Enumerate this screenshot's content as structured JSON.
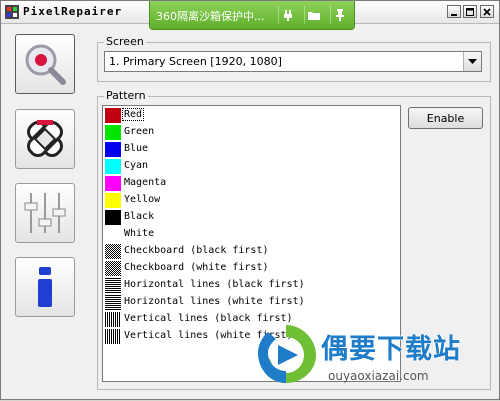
{
  "window": {
    "title": "PixelRepairer"
  },
  "sandbox": {
    "text": "360隔离沙箱保护中..."
  },
  "screen": {
    "label": "Screen",
    "selected": "1. Primary Screen [1920, 1080]"
  },
  "pattern": {
    "label": "Pattern",
    "enable_label": "Enable",
    "items": [
      {
        "label": "Red",
        "color": "#c00010"
      },
      {
        "label": "Green",
        "color": "#00e600"
      },
      {
        "label": "Blue",
        "color": "#0000f0"
      },
      {
        "label": "Cyan",
        "color": "#00ffff"
      },
      {
        "label": "Magenta",
        "color": "#ff00ff"
      },
      {
        "label": "Yellow",
        "color": "#ffff00"
      },
      {
        "label": "Black",
        "color": "#000000"
      },
      {
        "label": "White",
        "color": "#ffffff"
      },
      {
        "label": "Checkboard (black first)",
        "pattern": "checker"
      },
      {
        "label": "Checkboard (white first)",
        "pattern": "checker"
      },
      {
        "label": "Horizontal lines (black first)",
        "pattern": "hlines"
      },
      {
        "label": "Horizontal lines (white first)",
        "pattern": "hlines"
      },
      {
        "label": "Vertical lines (black first)",
        "pattern": "vlines"
      },
      {
        "label": "Vertical lines (white first)",
        "pattern": "vlines"
      }
    ]
  },
  "watermark": {
    "title": "偶要下载站",
    "url": "ouyaoxiazai.com"
  }
}
